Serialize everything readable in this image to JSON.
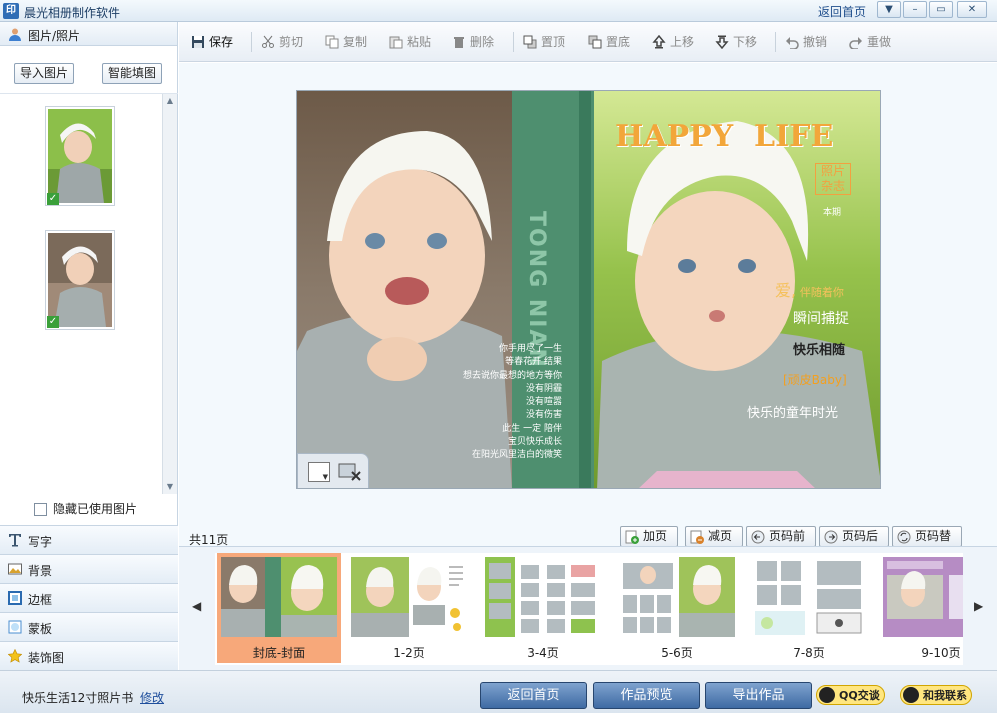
{
  "app": {
    "title": "晨光相册制作软件",
    "icon_text": "印",
    "home_link": "返回首页"
  },
  "window_controls": [
    "▼",
    "–",
    "▭",
    "✕"
  ],
  "sidebar": {
    "header": "图片/照片",
    "import_btn": "导入图片",
    "smart_fill_btn": "智能填图",
    "hide_used": "隐藏已使用图片",
    "categories": [
      "写字",
      "背景",
      "边框",
      "蒙板",
      "装饰图"
    ]
  },
  "toolbar": {
    "items": [
      "保存",
      "剪切",
      "复制",
      "粘贴",
      "删除",
      "置顶",
      "置底",
      "上移",
      "下移",
      "撤销",
      "重做"
    ]
  },
  "cover": {
    "spine_text": "TONG NIAN",
    "title": "HAPPY  LIFE",
    "badge_line1": "照片",
    "badge_line2": "杂志",
    "badge_sub": "本期",
    "love_main": "爱,",
    "love_sub": "伴随着你",
    "captures": "瞬间捕捉",
    "happy_together": "快乐相随",
    "naughty": "[顽皮Baby]",
    "childhood": "快乐的童年时光",
    "poem": [
      "你手用尽了一生",
      "等春花开  结果",
      "想去说你最想的地方等你",
      "没有阴霾",
      "没有喧嚣",
      "没有伤害",
      "此生  一定  陪伴",
      "宝贝快乐成长",
      "在阳光风里洁白的微笑"
    ]
  },
  "pages_header": {
    "count": "共11页",
    "add": "加页",
    "remove": "减页",
    "move_prev": "页码前移",
    "move_next": "页码后移",
    "replace": "页码替换"
  },
  "page_thumbs": [
    "封底-封面",
    "1-2页",
    "3-4页",
    "5-6页",
    "7-8页",
    "9-10页"
  ],
  "status": {
    "book": "快乐生活12寸照片书",
    "edit": "修改",
    "back_home": "返回首页",
    "preview": "作品预览",
    "export": "导出作品",
    "qq": "QQ交谈",
    "contact": "和我联系"
  },
  "colors": {
    "accent": "#3e6aa3",
    "spine": "#4e8f6f",
    "title_orange": "#f2a63a",
    "selected_page": "#f7a87a"
  }
}
